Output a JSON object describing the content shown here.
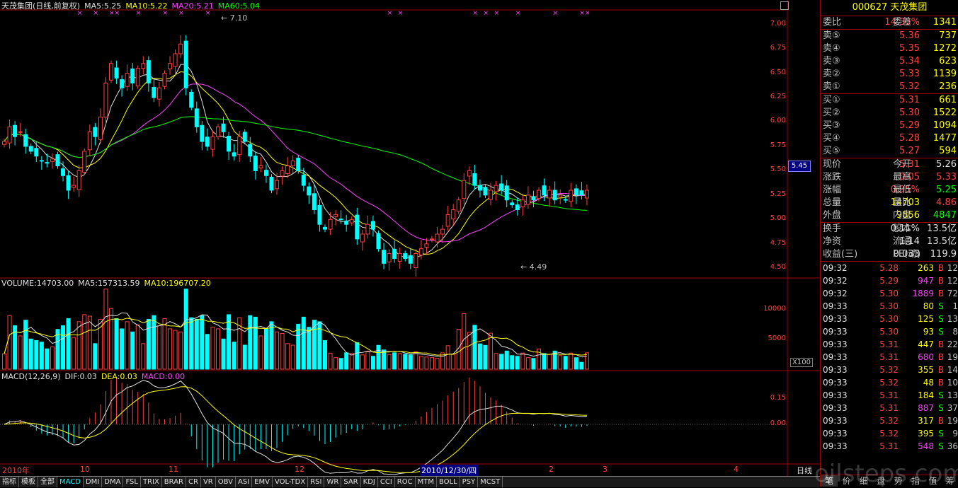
{
  "price_legend": {
    "title": "天茂集团(日线,前复权)",
    "ma5": "MA5:5.25",
    "ma10": "MA10:5.22",
    "ma20": "MA20:5.21",
    "ma60": "MA60:5.04"
  },
  "price_axis": [
    "7.00",
    "6.75",
    "6.50",
    "6.25",
    "6.00",
    "5.75",
    "5.50",
    "5.25",
    "5.00",
    "4.75",
    "4.50"
  ],
  "current_price_tag": "5.45",
  "annotations": {
    "high": "7.10",
    "low": "4.49"
  },
  "volume_legend": {
    "vol": "VOLUME:14703.00",
    "ma5": "MA5:157313.59",
    "ma10": "MA10:196707.20"
  },
  "volume_axis": [
    "10000",
    "5000"
  ],
  "volume_unit": "X100",
  "macd_legend": {
    "name": "MACD(12,26,9)",
    "dif": "DIF:0.03",
    "dea": "DEA:0.03",
    "macd": "MACD:0.00"
  },
  "macd_axis": [
    "0.15",
    "0.00"
  ],
  "date_axis": [
    "2010年",
    "10",
    "11",
    "12",
    "2010/12/30/四",
    "2",
    "3",
    "4"
  ],
  "period_label": "日线",
  "watermark": "oilsteps.com.au",
  "tabs": [
    "指标",
    "模板",
    "全部",
    "MACD",
    "DMI",
    "DMA",
    "FSL",
    "TRIX",
    "BRAR",
    "CR",
    "VR",
    "OBV",
    "ASI",
    "EMV",
    "VOL-TDX",
    "RSI",
    "WR",
    "SAR",
    "KDJ",
    "CCI",
    "ROC",
    "MTM",
    "BOLL",
    "PSY",
    "MCST"
  ],
  "quote": {
    "code_name": "000627 天茂集团",
    "weibi_label": "委比",
    "weibi": "14.33%",
    "weicha_label": "委差",
    "weicha": "1341",
    "asks": [
      {
        "label": "卖⑤",
        "price": "5.36",
        "vol": "737"
      },
      {
        "label": "卖④",
        "price": "5.35",
        "vol": "1272"
      },
      {
        "label": "卖③",
        "price": "5.34",
        "vol": "623"
      },
      {
        "label": "卖②",
        "price": "5.33",
        "vol": "1139"
      },
      {
        "label": "卖①",
        "price": "5.32",
        "vol": "236"
      }
    ],
    "bids": [
      {
        "label": "买①",
        "price": "5.31",
        "vol": "661"
      },
      {
        "label": "买②",
        "price": "5.30",
        "vol": "1522"
      },
      {
        "label": "买③",
        "price": "5.29",
        "vol": "1094"
      },
      {
        "label": "买④",
        "price": "5.28",
        "vol": "1477"
      },
      {
        "label": "买⑤",
        "price": "5.27",
        "vol": "594"
      }
    ],
    "stats": [
      {
        "l1": "现价",
        "v1": "5.31",
        "c1": "red",
        "l2": "今开",
        "v2": "5.26",
        "c2": "wht"
      },
      {
        "l1": "涨跌",
        "v1": "0.05",
        "c1": "red",
        "l2": "最高",
        "v2": "5.33",
        "c2": "red"
      },
      {
        "l1": "涨幅",
        "v1": "0.95%",
        "c1": "red",
        "l2": "最低",
        "v2": "5.25",
        "c2": "grn"
      },
      {
        "l1": "总量",
        "v1": "14703",
        "c1": "yel",
        "l2": "量比",
        "v2": "4.86",
        "c2": "red"
      },
      {
        "l1": "外盘",
        "v1": "9856",
        "c1": "yel",
        "l2": "内盘",
        "v2": "4847",
        "c2": "grn"
      }
    ],
    "stats2": [
      {
        "l1": "换手",
        "v1": "0.11%",
        "l2": "股本",
        "v2": "13.5亿"
      },
      {
        "l1": "净资",
        "v1": "1.14",
        "l2": "流通",
        "v2": "13.5亿"
      },
      {
        "l1": "收益(三)",
        "v1": "0.033",
        "l2": "PE(动)",
        "v2": "119.9"
      }
    ],
    "ticks": [
      {
        "t": "09:32",
        "p": "5.28",
        "pc": "red",
        "v": "263",
        "vc": "yel",
        "f": "B",
        "fc": "red",
        "n": "12"
      },
      {
        "t": "09:32",
        "p": "5.29",
        "pc": "red",
        "v": "947",
        "vc": "pnk",
        "f": "B",
        "fc": "red",
        "n": "12"
      },
      {
        "t": "09:32",
        "p": "5.30",
        "pc": "red",
        "v": "1889",
        "vc": "pnk",
        "f": "B",
        "fc": "red",
        "n": "72"
      },
      {
        "t": "09:33",
        "p": "5.30",
        "pc": "red",
        "v": "80",
        "vc": "yel",
        "f": "S",
        "fc": "grn",
        "n": "1"
      },
      {
        "t": "09:33",
        "p": "5.30",
        "pc": "red",
        "v": "125",
        "vc": "yel",
        "f": "S",
        "fc": "grn",
        "n": "13"
      },
      {
        "t": "09:33",
        "p": "5.30",
        "pc": "red",
        "v": "93",
        "vc": "yel",
        "f": "S",
        "fc": "grn",
        "n": "8"
      },
      {
        "t": "09:33",
        "p": "5.31",
        "pc": "red",
        "v": "447",
        "vc": "yel",
        "f": "B",
        "fc": "red",
        "n": "22"
      },
      {
        "t": "09:33",
        "p": "5.31",
        "pc": "red",
        "v": "680",
        "vc": "pnk",
        "f": "B",
        "fc": "red",
        "n": "19"
      },
      {
        "t": "09:33",
        "p": "5.32",
        "pc": "red",
        "v": "355",
        "vc": "yel",
        "f": "B",
        "fc": "red",
        "n": "14"
      },
      {
        "t": "09:33",
        "p": "5.32",
        "pc": "red",
        "v": "48",
        "vc": "yel",
        "f": "B",
        "fc": "red",
        "n": "10"
      },
      {
        "t": "09:33",
        "p": "5.31",
        "pc": "red",
        "v": "184",
        "vc": "yel",
        "f": "S",
        "fc": "grn",
        "n": "13"
      },
      {
        "t": "09:33",
        "p": "5.31",
        "pc": "red",
        "v": "887",
        "vc": "pnk",
        "f": "S",
        "fc": "grn",
        "n": "37"
      },
      {
        "t": "09:33",
        "p": "5.32",
        "pc": "red",
        "v": "317",
        "vc": "yel",
        "f": "B",
        "fc": "red",
        "n": "19"
      },
      {
        "t": "09:33",
        "p": "5.32",
        "pc": "red",
        "v": "395",
        "vc": "yel",
        "f": "S",
        "fc": "grn",
        "n": "9"
      },
      {
        "t": "09:33",
        "p": "5.31",
        "pc": "red",
        "v": "548",
        "vc": "pnk",
        "f": "S",
        "fc": "grn",
        "n": "36"
      }
    ],
    "bottom_tabs": [
      "笔",
      "价",
      "细",
      "盘",
      "势",
      "指",
      "值",
      "筹"
    ]
  },
  "colors": {
    "up": "#ff4040",
    "down": "#00ffff",
    "ma5": "#e0e0e0",
    "ma10": "#ffff00",
    "ma20": "#ff40ff",
    "ma60": "#00ff00",
    "grid": "#a00000"
  },
  "chart_data": {
    "type": "candlestick",
    "ylim": [
      4.4,
      7.15
    ],
    "volume_ylim": [
      0,
      14000
    ],
    "macd_ylim": [
      -0.3,
      0.22
    ],
    "close": [
      5.8,
      5.95,
      5.85,
      5.9,
      5.75,
      5.7,
      5.65,
      5.6,
      5.58,
      5.62,
      5.55,
      5.45,
      5.3,
      5.35,
      5.5,
      5.7,
      5.9,
      5.85,
      6.05,
      6.4,
      6.6,
      6.45,
      6.35,
      6.5,
      6.4,
      6.55,
      6.6,
      6.4,
      6.25,
      6.35,
      6.5,
      6.6,
      6.7,
      6.8,
      6.35,
      6.15,
      5.95,
      5.8,
      5.75,
      5.85,
      5.95,
      5.9,
      5.7,
      5.65,
      5.85,
      5.8,
      5.65,
      5.5,
      5.55,
      5.45,
      5.3,
      5.4,
      5.5,
      5.55,
      5.6,
      5.5,
      5.35,
      5.25,
      5.1,
      4.95,
      4.9,
      5.0,
      5.05,
      5.0,
      4.95,
      5.0,
      4.8,
      4.85,
      4.95,
      4.9,
      4.7,
      4.55,
      4.65,
      4.6,
      4.65,
      4.6,
      4.55,
      4.65,
      4.7,
      4.75,
      4.8,
      4.85,
      4.9,
      5.05,
      5.1,
      5.2,
      5.4,
      5.5,
      5.35,
      5.3,
      5.25,
      5.3,
      5.35,
      5.3,
      5.2,
      5.15,
      5.1,
      5.2,
      5.25,
      5.2,
      5.3,
      5.25,
      5.3,
      5.2,
      5.25,
      5.2,
      5.3,
      5.25,
      5.25,
      5.3
    ]
  }
}
